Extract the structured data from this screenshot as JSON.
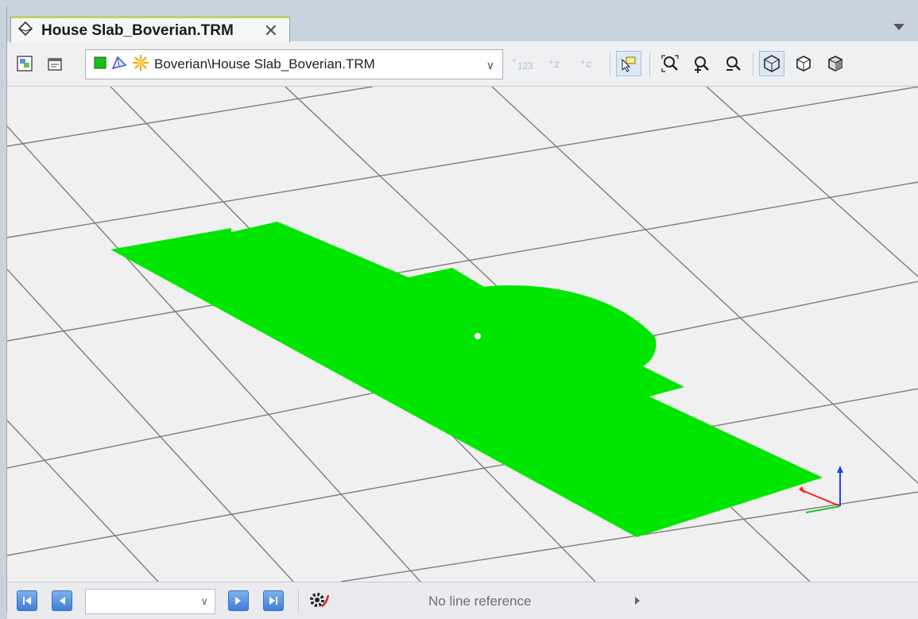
{
  "tab": {
    "title": "House Slab_Boverian.TRM",
    "close": "✕"
  },
  "toolbar": {
    "model_path": "Boverian\\House Slab_Boverian.TRM",
    "icons": [
      "view-layers-icon",
      "properties-icon",
      "green-layer-icon",
      "surface-icon",
      "highlight-icon"
    ],
    "disabled_labels": {
      "add_point": "123",
      "add_z": "z",
      "add_c": "c"
    }
  },
  "status": {
    "reference": "No line reference"
  },
  "colors": {
    "surface": "#00e600",
    "grid": "#7d7d7d",
    "viewport_bg": "#f0f0f0",
    "tab_accent": "#b8d36a"
  }
}
